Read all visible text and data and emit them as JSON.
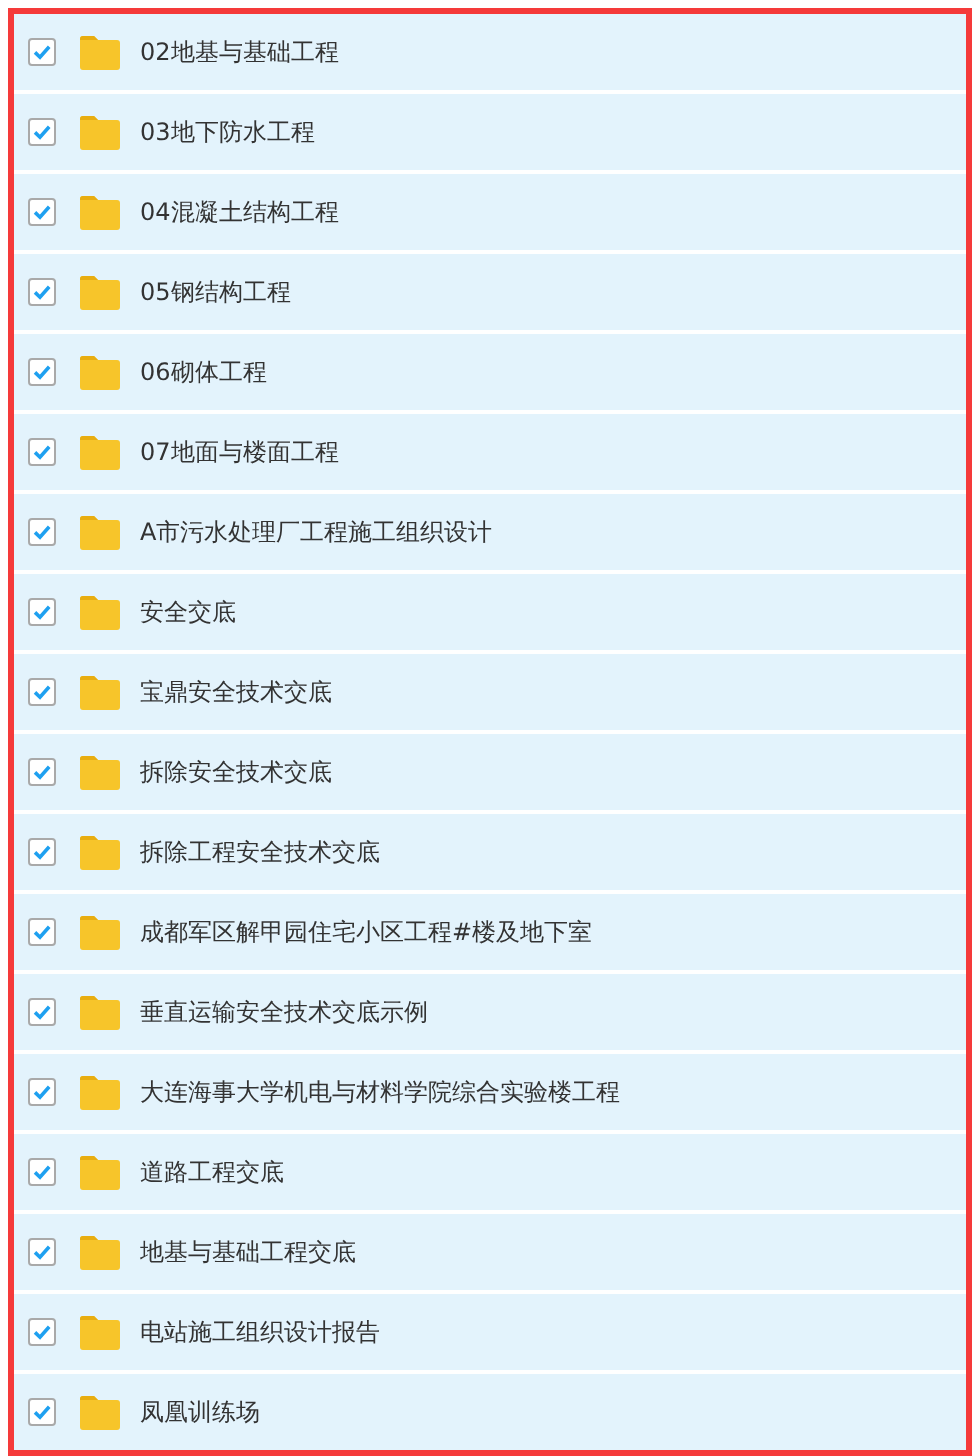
{
  "items": [
    {
      "name": "02地基与基础工程",
      "checked": true
    },
    {
      "name": "03地下防水工程",
      "checked": true
    },
    {
      "name": "04混凝土结构工程",
      "checked": true
    },
    {
      "name": "05钢结构工程",
      "checked": true
    },
    {
      "name": "06砌体工程",
      "checked": true
    },
    {
      "name": "07地面与楼面工程",
      "checked": true
    },
    {
      "name": "A市污水处理厂工程施工组织设计",
      "checked": true
    },
    {
      "name": "安全交底",
      "checked": true
    },
    {
      "name": "宝鼎安全技术交底",
      "checked": true
    },
    {
      "name": "拆除安全技术交底",
      "checked": true
    },
    {
      "name": "拆除工程安全技术交底",
      "checked": true
    },
    {
      "name": "成都军区解甲园住宅小区工程#楼及地下室",
      "checked": true
    },
    {
      "name": "垂直运输安全技术交底示例",
      "checked": true
    },
    {
      "name": "大连海事大学机电与材料学院综合实验楼工程",
      "checked": true
    },
    {
      "name": "道路工程交底",
      "checked": true
    },
    {
      "name": "地基与基础工程交底",
      "checked": true
    },
    {
      "name": "电站施工组织设计报告",
      "checked": true
    },
    {
      "name": "凤凰训练场",
      "checked": true
    }
  ]
}
